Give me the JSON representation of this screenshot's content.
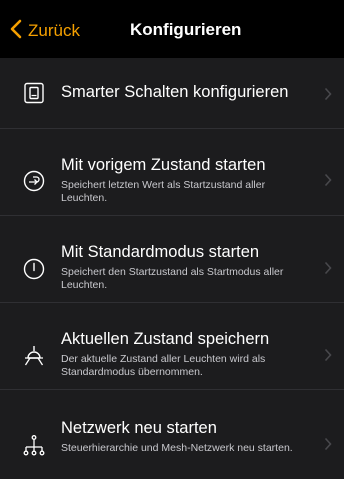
{
  "nav": {
    "back_label": "Zurück",
    "title": "Konfigurieren"
  },
  "colors": {
    "accent": "#f5a000",
    "background": "#1c1c1e",
    "navbar": "#000000"
  },
  "items": [
    {
      "title": "Smarter Schalten konfigurieren",
      "description": "",
      "icon": "switch-icon"
    },
    {
      "title": "Mit vorigem Zustand starten",
      "description": "Speichert letzten Wert als Startzustand aller Leuchten.",
      "icon": "restore-icon"
    },
    {
      "title": "Mit Standardmodus starten",
      "description": "Speichert den Startzustand als Startmodus aller Leuchten.",
      "icon": "power-icon"
    },
    {
      "title": "Aktuellen Zustand speichern",
      "description": "Der aktuelle Zustand aller Leuchten wird als Standardmodus übernommen.",
      "icon": "lamp-icon"
    },
    {
      "title": "Netzwerk neu starten",
      "description": "Steuerhierarchie und Mesh-Netzwerk neu starten.",
      "icon": "network-icon"
    }
  ]
}
